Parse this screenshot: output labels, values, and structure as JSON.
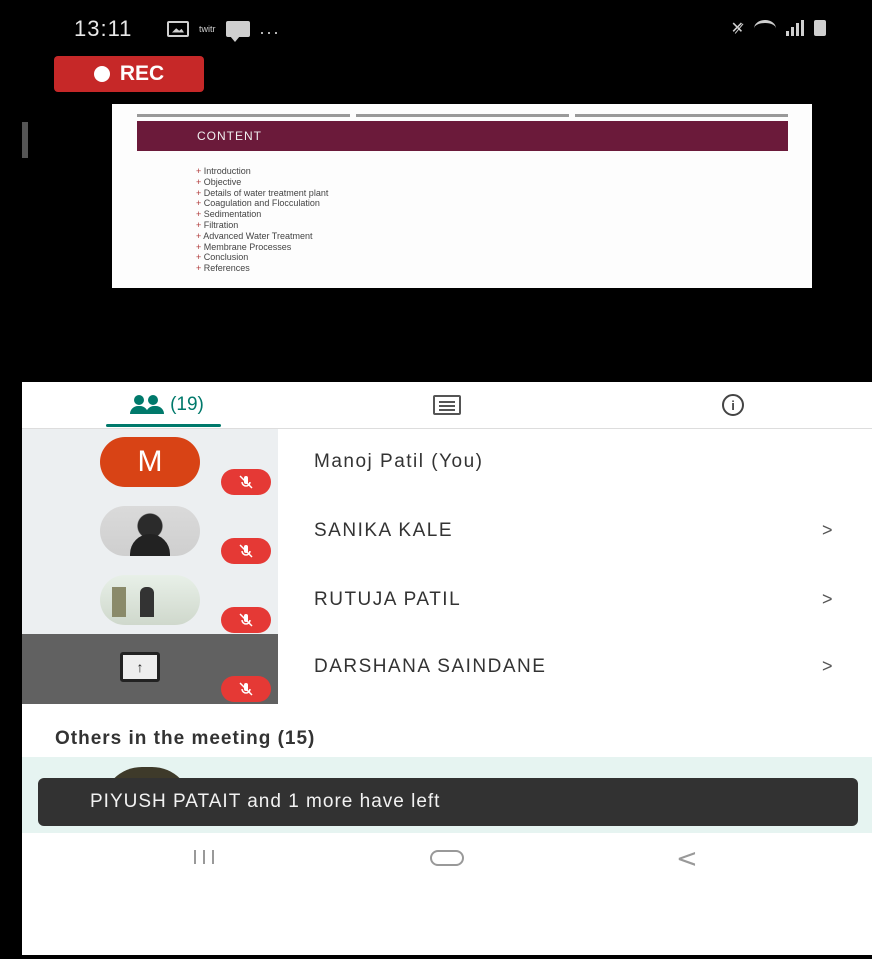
{
  "status_bar": {
    "time": "13:11",
    "extra_icons": "...",
    "left_icons": [
      "gallery-icon",
      "app-icon",
      "message-icon"
    ],
    "right_icons": [
      "vibrate-icon",
      "wifi-icon",
      "signal-icon",
      "battery-icon"
    ]
  },
  "recording": {
    "label": "REC",
    "color": "#c62828"
  },
  "slide": {
    "header": "CONTENT",
    "header_color": "#6b1a3a",
    "items": [
      "Introduction",
      "Objective",
      "Details of water treatment plant",
      "Coagulation and Flocculation",
      "Sedimentation",
      "Filtration",
      "Advanced Water Treatment",
      "Membrane Processes",
      "Conclusion",
      "References"
    ]
  },
  "tabs": {
    "people_count": "(19)",
    "accent": "#00796b"
  },
  "participants": [
    {
      "initial": "M",
      "name": "Manoj Patil (You)",
      "chevron": ""
    },
    {
      "initial": "",
      "name": "SANIKA KALE",
      "chevron": ">"
    },
    {
      "initial": "",
      "name": "RUTUJA PATIL",
      "chevron": ">"
    },
    {
      "initial": "",
      "name": "DARSHANA SAINDANE",
      "chevron": ">"
    }
  ],
  "others": {
    "heading": "Others in the meeting (15)"
  },
  "toast": {
    "text": "PIYUSH PATAIT and 1 more have left"
  }
}
